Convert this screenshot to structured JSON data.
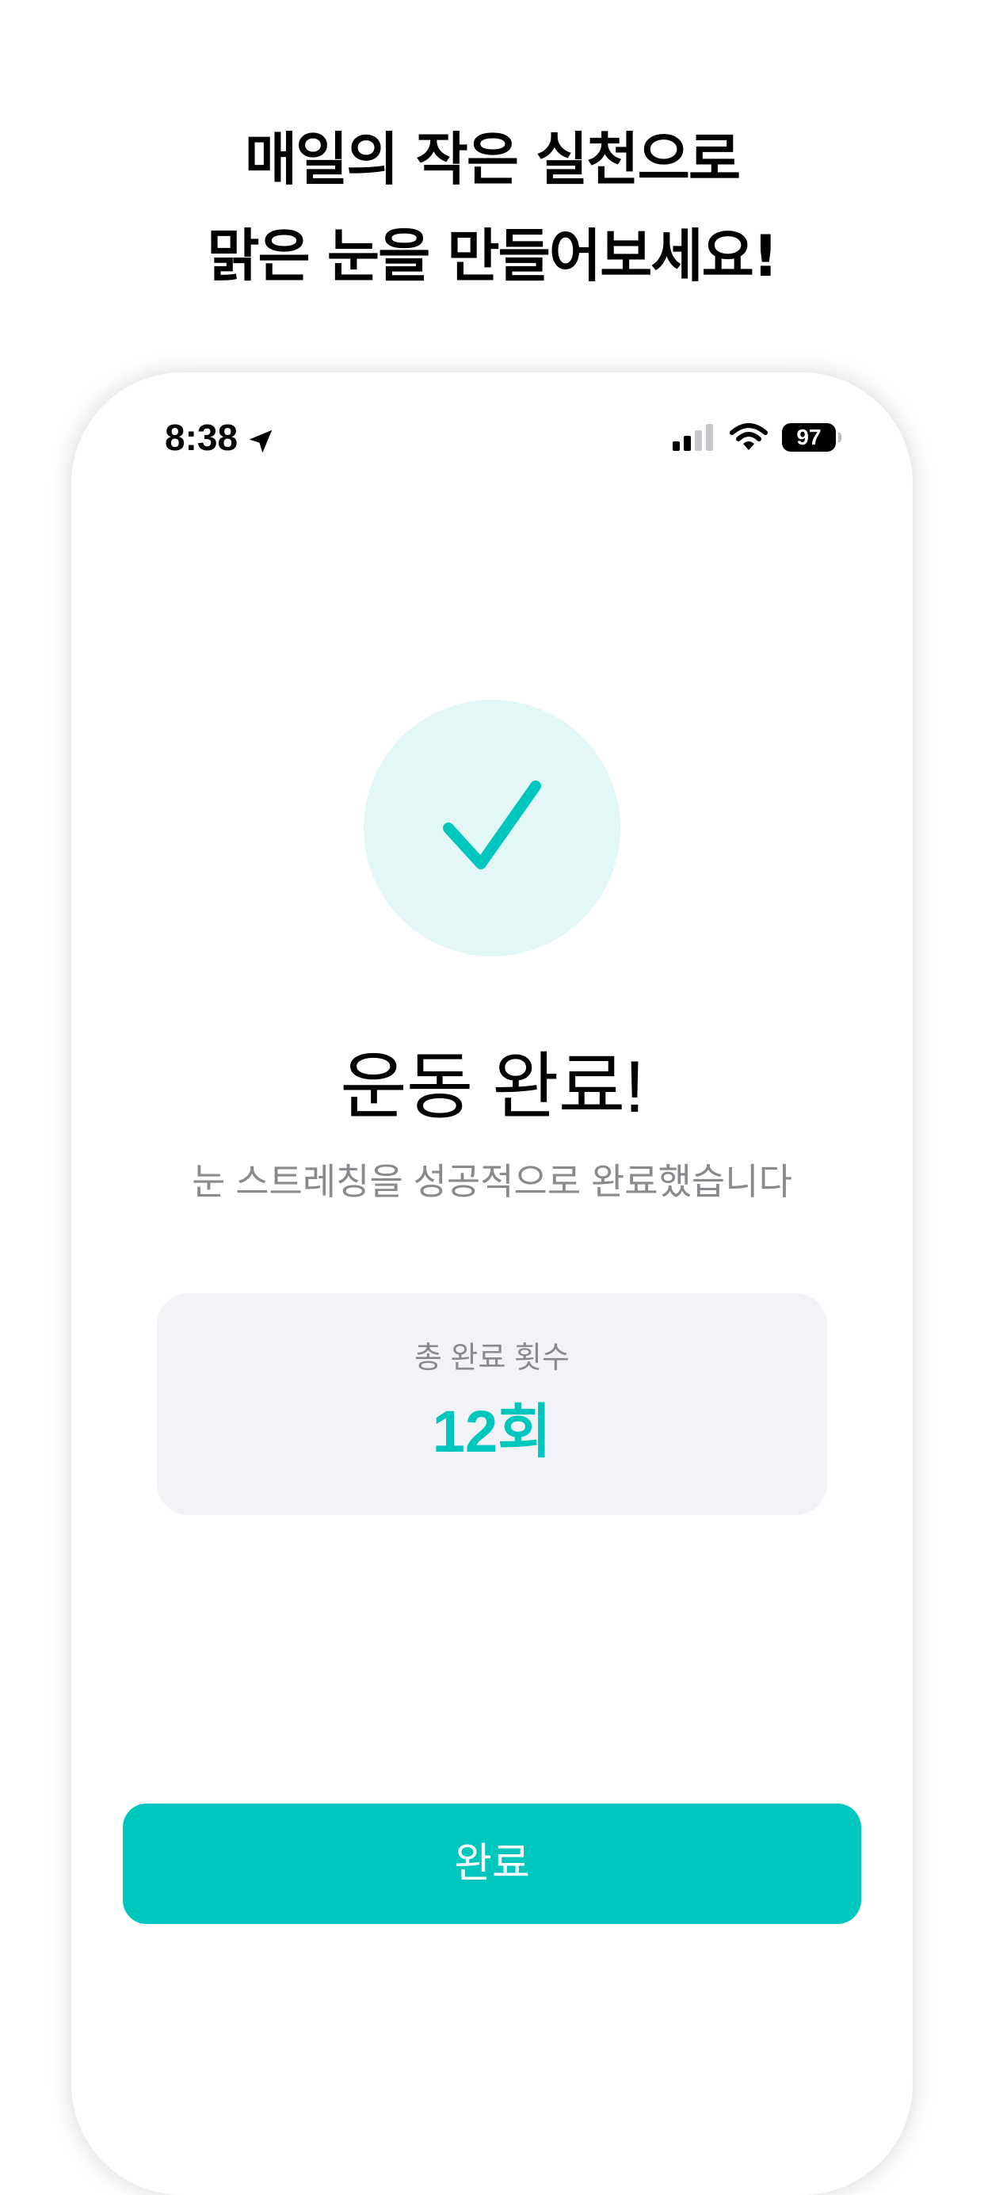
{
  "headline": {
    "line1": "매일의 작은 실천으로",
    "line2": "맑은 눈을 만들어보세요!"
  },
  "status_bar": {
    "time": "8:38",
    "battery": "97",
    "icons": [
      "location-arrow-icon",
      "cellular-signal-icon",
      "wifi-icon",
      "battery-icon"
    ]
  },
  "result": {
    "icon": "checkmark-icon",
    "title": "운동 완료!",
    "subtitle": "눈 스트레칭을 성공적으로 완료했습니다"
  },
  "stats": {
    "label": "총 완료 횟수",
    "value": "12회"
  },
  "actions": {
    "complete_label": "완료"
  },
  "colors": {
    "accent": "#00c7be",
    "accent_light": "#e3f7f6",
    "card_background": "#f2f2f7",
    "secondary_text": "#8a8a8e"
  }
}
